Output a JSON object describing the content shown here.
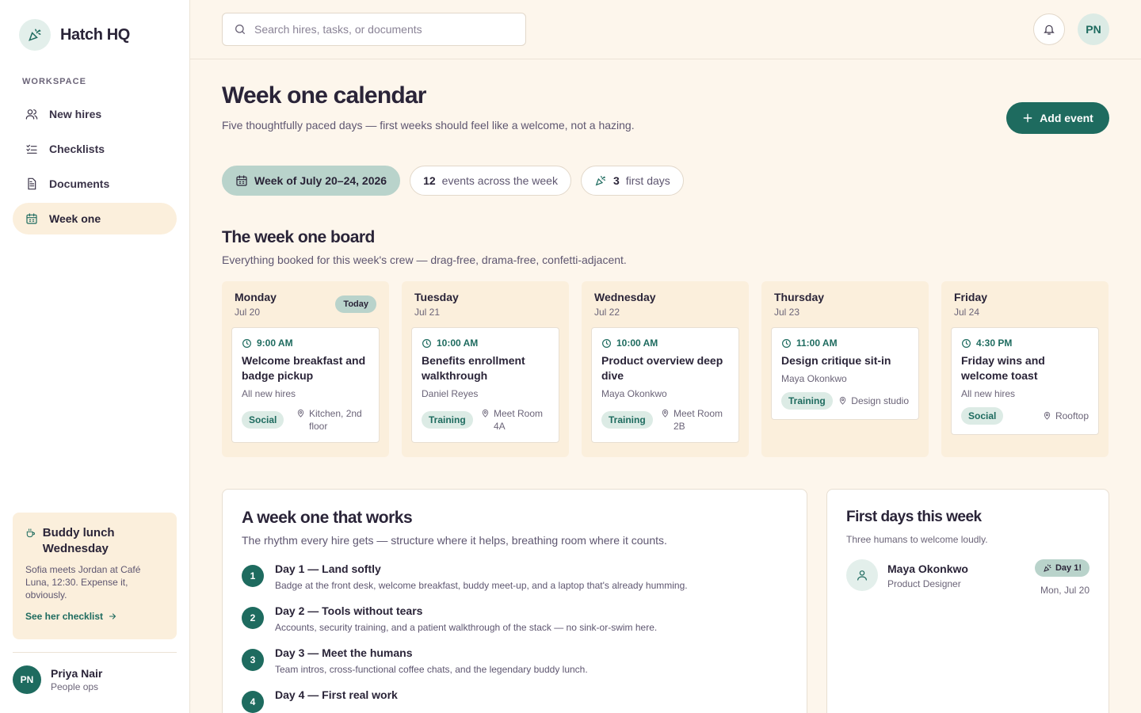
{
  "brand": {
    "name": "Hatch HQ"
  },
  "sidebar": {
    "section_label": "WORKSPACE",
    "items": [
      {
        "label": "New hires",
        "icon": "users-icon"
      },
      {
        "label": "Checklists",
        "icon": "checklist-icon"
      },
      {
        "label": "Documents",
        "icon": "document-icon"
      },
      {
        "label": "Week one",
        "icon": "calendar-icon",
        "active": true
      }
    ],
    "promo": {
      "title": "Buddy lunch Wednesday",
      "text": "Sofia meets Jordan at Café Luna, 12:30. Expense it, obviously.",
      "link": "See her checklist"
    },
    "user": {
      "initials": "PN",
      "name": "Priya Nair",
      "role": "People ops"
    }
  },
  "topbar": {
    "search_placeholder": "Search hires, tasks, or documents",
    "avatar_initials": "PN"
  },
  "header": {
    "title": "Week one calendar",
    "subtitle": "Five thoughtfully paced days — first weeks should feel like a welcome, not a hazing.",
    "add_button": "Add event"
  },
  "chips": {
    "week": "Week of July 20–24, 2026",
    "events_count": "12",
    "events_label": "events across the week",
    "first_days_count": "3",
    "first_days_label": "first days"
  },
  "board": {
    "title": "The week one board",
    "subtitle": "Everything booked for this week's crew — drag-free, drama-free, confetti-adjacent.",
    "today_label": "Today",
    "days": [
      {
        "name": "Monday",
        "date": "Jul 20",
        "event": {
          "time": "9:00 AM",
          "title": "Welcome breakfast and badge pickup",
          "owner": "All new hires",
          "tag": "Social",
          "location": "Kitchen, 2nd floor"
        }
      },
      {
        "name": "Tuesday",
        "date": "Jul 21",
        "event": {
          "time": "10:00 AM",
          "title": "Benefits enrollment walkthrough",
          "owner": "Daniel Reyes",
          "tag": "Training",
          "location": "Meet Room 4A"
        }
      },
      {
        "name": "Wednesday",
        "date": "Jul 22",
        "event": {
          "time": "10:00 AM",
          "title": "Product overview deep dive",
          "owner": "Maya Okonkwo",
          "tag": "Training",
          "location": "Meet Room 2B"
        }
      },
      {
        "name": "Thursday",
        "date": "Jul 23",
        "event": {
          "time": "11:00 AM",
          "title": "Design critique sit-in",
          "owner": "Maya Okonkwo",
          "tag": "Training",
          "location": "Design studio"
        }
      },
      {
        "name": "Friday",
        "date": "Jul 24",
        "event": {
          "time": "4:30 PM",
          "title": "Friday wins and welcome toast",
          "owner": "All new hires",
          "tag": "Social",
          "location": "Rooftop"
        }
      }
    ]
  },
  "rhythm": {
    "title": "A week one that works",
    "subtitle": "The rhythm every hire gets — structure where it helps, breathing room where it counts.",
    "steps": [
      {
        "num": "1",
        "title": "Day 1 — Land softly",
        "desc": "Badge at the front desk, welcome breakfast, buddy meet-up, and a laptop that's already humming."
      },
      {
        "num": "2",
        "title": "Day 2 — Tools without tears",
        "desc": "Accounts, security training, and a patient walkthrough of the stack — no sink-or-swim here."
      },
      {
        "num": "3",
        "title": "Day 3 — Meet the humans",
        "desc": "Team intros, cross-functional coffee chats, and the legendary buddy lunch."
      },
      {
        "num": "4",
        "title": "Day 4 — First real work",
        "desc": ""
      }
    ]
  },
  "first_days": {
    "title": "First days this week",
    "subtitle": "Three humans to welcome loudly.",
    "hires": [
      {
        "name": "Maya Okonkwo",
        "role": "Product Designer",
        "badge": "Day 1!",
        "date": "Mon, Jul 20"
      }
    ]
  },
  "colors": {
    "accent": "#1e6b5f",
    "background": "#fdf6ec",
    "day_column": "#fbefdc",
    "chip": "#b9d3cb"
  }
}
